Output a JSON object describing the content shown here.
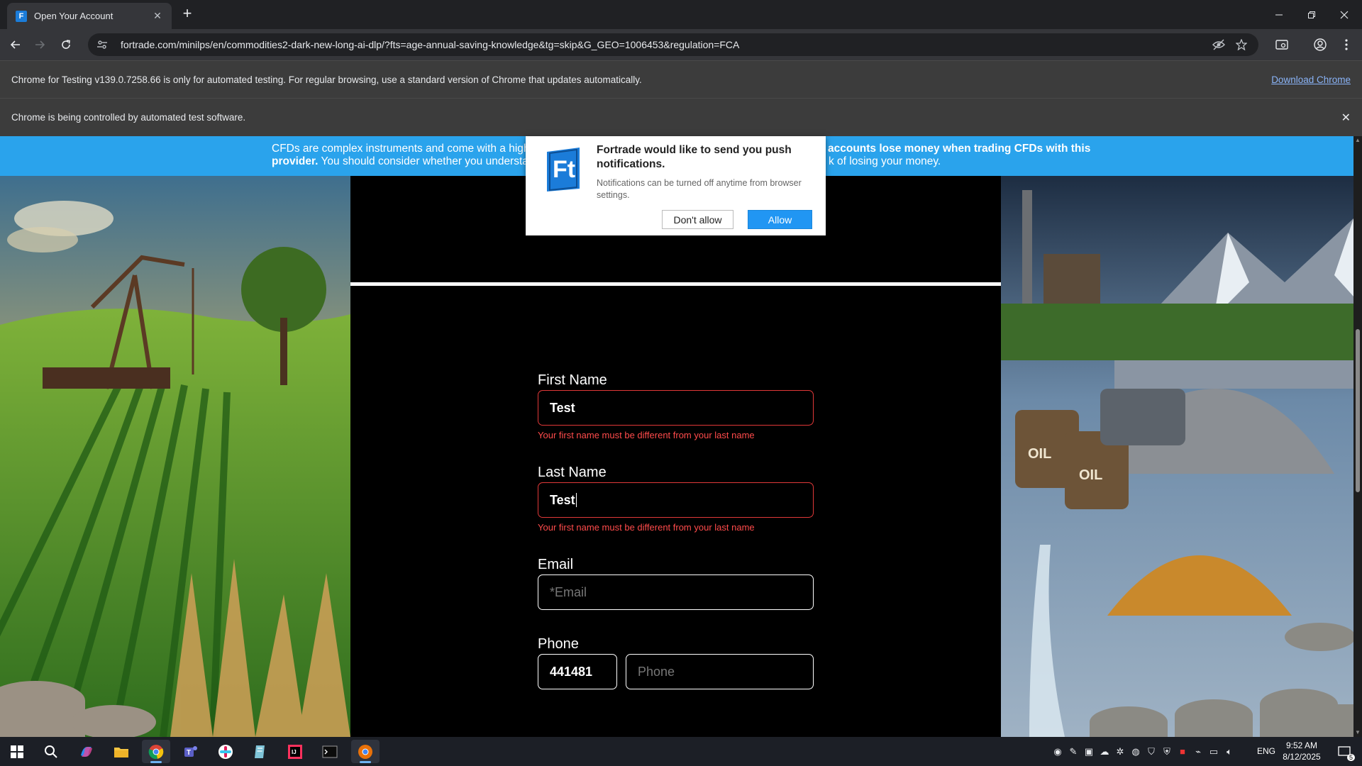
{
  "browser": {
    "tab_title": "Open Your Account",
    "tab_favicon_letter": "F",
    "url": "fortrade.com/minilps/en/commodities2-dark-new-long-ai-dlp/?fts=age-annual-saving-knowledge&tg=skip&G_GEO=1006453&regulation=FCA",
    "infobar_testing": "Chrome for Testing v139.0.7258.66 is only for automated testing. For regular browsing, use a standard version of Chrome that updates automatically.",
    "infobar_download_link": "Download Chrome",
    "infobar_automation": "Chrome is being controlled by automated test software."
  },
  "risk_banner": {
    "line1_left": "CFDs are complex instruments and come with a high ris",
    "line1_right": "accounts lose money when trading CFDs with this",
    "line2_left_bold": "provider.",
    "line2_left_rest": " You should consider whether you understand",
    "line2_right": "k of losing your money."
  },
  "push_dialog": {
    "heading": "Fortrade would like to send you push notifications.",
    "subtext": "Notifications can be turned off anytime from browser settings.",
    "deny_label": "Don't allow",
    "allow_label": "Allow",
    "logo_letters": "Ft",
    "brand_color": "#1b7cd9"
  },
  "form": {
    "first_name": {
      "label": "First Name",
      "value": "Test",
      "error": "Your first name must be different from your last name"
    },
    "last_name": {
      "label": "Last Name",
      "value": "Test",
      "error": "Your first name must be different from your last name"
    },
    "email": {
      "label": "Email",
      "placeholder": "*Email",
      "value": ""
    },
    "phone": {
      "label": "Phone",
      "prefix_value": "441481",
      "placeholder": "Phone"
    },
    "error_color": "#e03838"
  },
  "taskbar": {
    "language": "ENG",
    "time": "9:52 AM",
    "date": "8/12/2025",
    "notification_count": "5"
  },
  "scene": {
    "barrel_label_1": "OIL",
    "barrel_label_2": "OIL"
  }
}
